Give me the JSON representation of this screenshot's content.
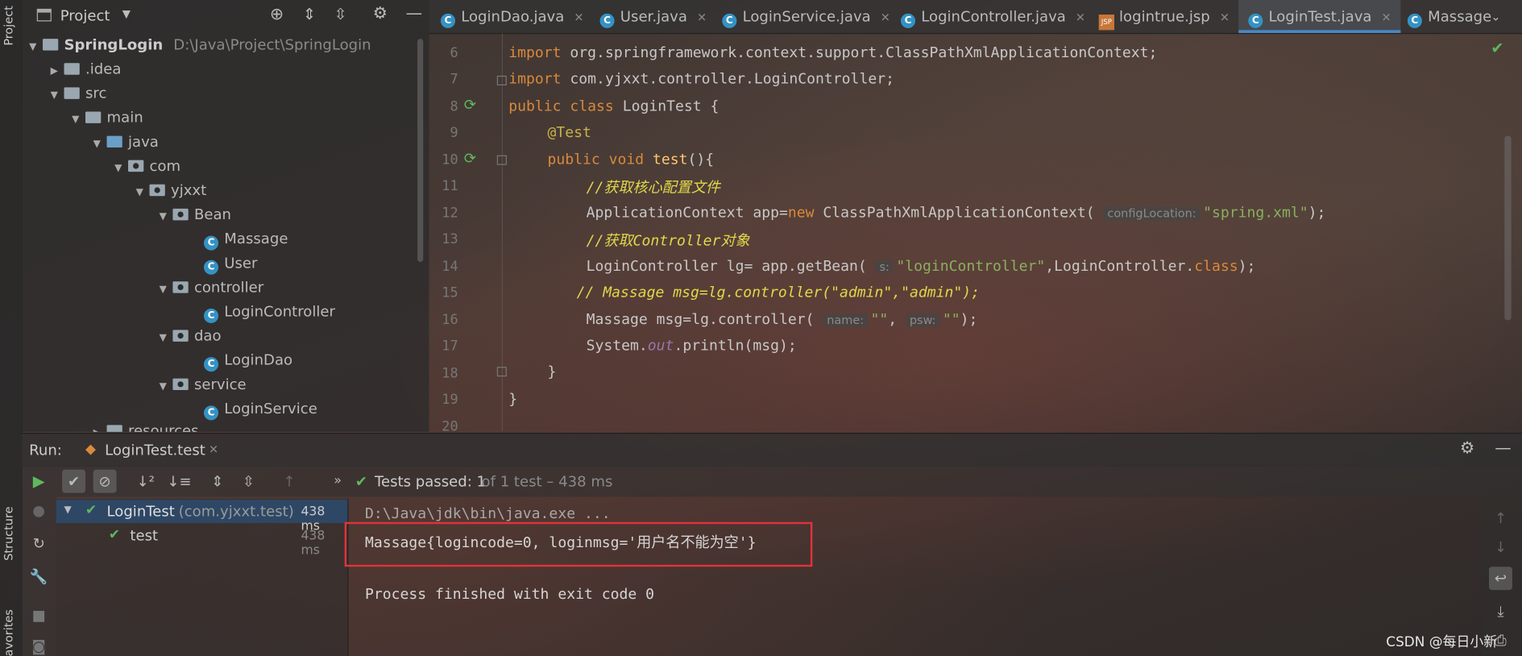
{
  "left_strip": {
    "project_label": "Project",
    "structure_label": "Structure",
    "favorites_label": "Favorites"
  },
  "project_panel": {
    "title": "Project",
    "root_name": "SpringLogin",
    "root_path": "D:\\Java\\Project\\SpringLogin",
    "items": [
      {
        "label": ".idea"
      },
      {
        "label": "src"
      },
      {
        "label": "main"
      },
      {
        "label": "java"
      },
      {
        "label": "com"
      },
      {
        "label": "yjxxt"
      },
      {
        "label": "Bean"
      },
      {
        "label": "Massage"
      },
      {
        "label": "User"
      },
      {
        "label": "controller"
      },
      {
        "label": "LoginController"
      },
      {
        "label": "dao"
      },
      {
        "label": "LoginDao"
      },
      {
        "label": "service"
      },
      {
        "label": "LoginService"
      },
      {
        "label": "resources"
      }
    ]
  },
  "tabs": [
    {
      "label": "LoginDao.java"
    },
    {
      "label": "User.java"
    },
    {
      "label": "LoginService.java"
    },
    {
      "label": "LoginController.java"
    },
    {
      "label": "logintrue.jsp",
      "icon_label": "JSP"
    },
    {
      "label": "LoginTest.java"
    },
    {
      "label": "Massage"
    }
  ],
  "editor": {
    "line_numbers": [
      "6",
      "7",
      "8",
      "9",
      "10",
      "11",
      "12",
      "13",
      "14",
      "15",
      "16",
      "17",
      "18",
      "19",
      "20"
    ],
    "code": {
      "l6_kw": "import ",
      "l6_rest": "org.springframework.context.support.ClassPathXmlApplicationContext;",
      "l7_kw": "import ",
      "l7_rest": "com.yjxxt.controller.LoginController;",
      "l8_kw": "public class ",
      "l8_rest": "LoginTest {",
      "l9": "@Test",
      "l10_kw": "public void ",
      "l10_fn": "test",
      "l10_rest": "(){",
      "l11_slash": "//",
      "l11_cn": "获取核心配置文件",
      "l12_a": "ApplicationContext app=",
      "l12_new": "new ",
      "l12_b": "ClassPathXmlApplicationContext(",
      "l12_hint": "configLocation:",
      "l12_str": "\"spring.xml\"",
      "l12_end": ");",
      "l13_slash": "//",
      "l13_cn1": "获取",
      "l13_mid": "Controller",
      "l13_cn2": "对象",
      "l14_a": "LoginController lg= app.getBean(",
      "l14_hint": "s:",
      "l14_str": "\"loginController\"",
      "l14_b": ",LoginController.",
      "l14_class": "class",
      "l14_end": ");",
      "l15": "// Massage msg=lg.controller(\"admin\",\"admin\");",
      "l16_a": "Massage msg=lg.controller(",
      "l16_hint1": "name:",
      "l16_str1": "\"\"",
      "l16_comma": ",",
      "l16_hint2": "psw:",
      "l16_str2": "\"\"",
      "l16_end": ");",
      "l17_a": "System.",
      "l17_out": "out",
      "l17_b": ".println(msg);",
      "l18": "}",
      "l19": "}"
    }
  },
  "run_panel": {
    "label": "Run:",
    "tab_label": "LoginTest.test",
    "status_passed": "Tests passed: 1",
    "status_detail": "of 1 test – 438 ms",
    "tests": [
      {
        "name": "LoginTest",
        "package": "(com.yjxxt.test)",
        "time": "438 ms"
      },
      {
        "name": "test",
        "time": "438 ms"
      }
    ],
    "console": [
      "D:\\Java\\jdk\\bin\\java.exe ...",
      "Massage{logincode=0, loginmsg='用户名不能为空'}",
      "",
      "Process finished with exit code 0"
    ]
  },
  "watermark": "CSDN @每日小新",
  "colors": {
    "accent": "#4a88c7",
    "pass_green": "#5fb85f",
    "highlight_box": "#e0333a"
  }
}
